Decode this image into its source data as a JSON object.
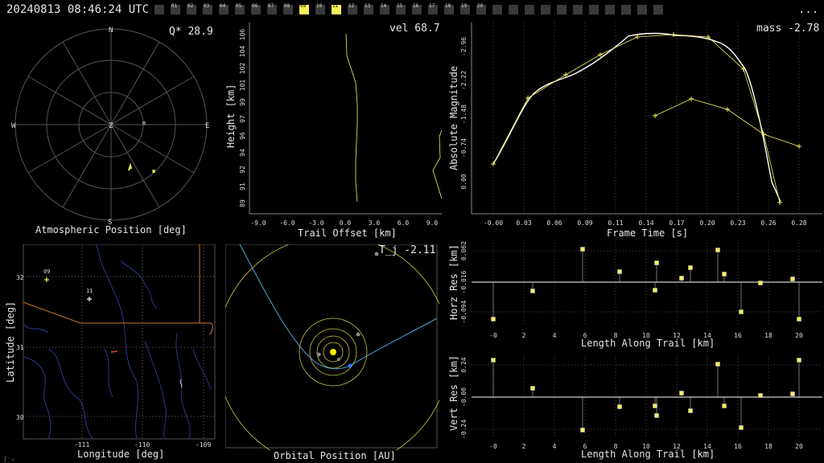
{
  "header": {
    "timestamp": "20240813 08:46:24 UTC",
    "menu": "...",
    "cameras": [
      "01",
      "02",
      "03",
      "04",
      "05",
      "06",
      "07",
      "08",
      "09",
      "10",
      "11",
      "12",
      "13",
      "14",
      "15",
      "16",
      "17",
      "18",
      "19",
      "20"
    ],
    "active": [
      "09",
      "11"
    ]
  },
  "polar": {
    "title": "Atmospheric Position [deg]",
    "readout": "Q* 28.9",
    "compass": {
      "n": "N",
      "s": "S",
      "e": "E",
      "w": "W",
      "z": "Z",
      "r": "R"
    }
  },
  "height_plot": {
    "readout": "vel 68.7",
    "ylabel": "Height [km]",
    "xlabel": "Trail Offset [km]",
    "yticks": [
      "89",
      "91",
      "92",
      "94",
      "96",
      "97",
      "99",
      "101",
      "102",
      "104",
      "106"
    ],
    "xticks": [
      "-9.0",
      "-6.0",
      "-3.0",
      "0.0",
      "3.0",
      "6.0",
      "9.0"
    ]
  },
  "mag_plot": {
    "readout": "mass -2.78",
    "ylabel": "Absolute Magnitude",
    "xlabel": "Frame Time [s]",
    "yticks": [
      "-2.96",
      "-2.22",
      "-1.48",
      "-0.74",
      "0.00"
    ],
    "xticks": [
      "-0.00",
      "0.03",
      "0.06",
      "0.09",
      "0.11",
      "0.14",
      "0.17",
      "0.20",
      "0.23",
      "0.26",
      "0.28"
    ]
  },
  "map": {
    "ylabel": "Latitude [deg]",
    "xlabel": "Longitude [deg]",
    "yticks": [
      "32",
      "31",
      "30"
    ],
    "xticks": [
      "-111",
      "-110",
      "-109"
    ],
    "stations": [
      "09",
      "11"
    ],
    "footer": "ʃ⁻ₓ"
  },
  "orbit": {
    "readout": "T_j -2.11",
    "xlabel": "Orbital Position [AU]"
  },
  "horz_res": {
    "ylabel": "Horz Res [km]",
    "xlabel": "Length Along Trail [km]",
    "yticks": [
      "0.062",
      "-0.016",
      "-0.094"
    ],
    "xticks": [
      "-0",
      "2",
      "4",
      "6",
      "8",
      "10",
      "12",
      "14",
      "16",
      "18",
      "20"
    ]
  },
  "vert_res": {
    "ylabel": "Vert Res [km]",
    "xlabel": "Length Along Trail [km]",
    "yticks": [
      "0.24",
      "-0.00",
      "-0.24"
    ],
    "xticks": [
      "-0",
      "2",
      "4",
      "6",
      "8",
      "10",
      "12",
      "14",
      "16",
      "18",
      "20"
    ]
  },
  "colors": {
    "accent": "#f4f05a",
    "grid": "#555555",
    "road": "#c8782a",
    "water": "#2a3f9a",
    "orbit": "#4aa8d8"
  }
}
